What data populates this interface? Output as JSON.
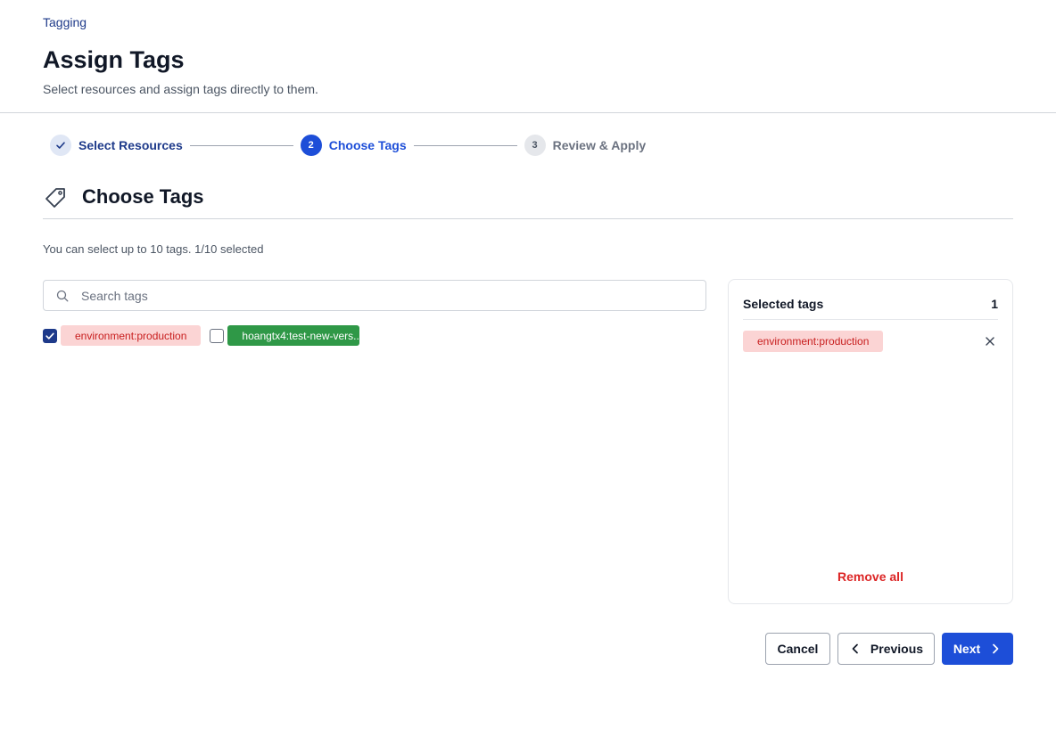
{
  "breadcrumb": "Tagging",
  "page": {
    "title": "Assign Tags",
    "subtitle": "Select resources and assign tags directly to them."
  },
  "stepper": {
    "steps": [
      {
        "number": "",
        "label": "Select Resources",
        "state": "completed"
      },
      {
        "number": "2",
        "label": "Choose Tags",
        "state": "active"
      },
      {
        "number": "3",
        "label": "Review & Apply",
        "state": "upcoming"
      }
    ]
  },
  "section": {
    "title": "Choose Tags",
    "icon": "tag-icon",
    "hint": "You can select up to 10 tags. 1/10 selected"
  },
  "search": {
    "placeholder": "Search tags",
    "value": ""
  },
  "tags": [
    {
      "label": "environment:production",
      "checked": true,
      "color": "#fbd4d4",
      "text_color": "#c81e1e"
    },
    {
      "label": "hoangtx4:test-new-vers...",
      "checked": false,
      "color": "#2f9847",
      "text_color": "#ffffff"
    }
  ],
  "selected_panel": {
    "title": "Selected tags",
    "count": "1",
    "items": [
      {
        "label": "environment:production"
      }
    ],
    "remove_all_label": "Remove all"
  },
  "actions": {
    "cancel_label": "Cancel",
    "previous_label": "Previous",
    "next_label": "Next"
  },
  "colors": {
    "primary": "#1d4ed8",
    "danger": "#dc2626",
    "breadcrumb": "#1e3a8a"
  }
}
